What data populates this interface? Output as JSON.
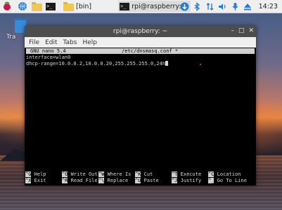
{
  "taskbar": {
    "folder_label": "[bin]",
    "terminal_label": "rpi@raspberry: ~",
    "clock": "14:23"
  },
  "desktop": {
    "trash_label": "Tra"
  },
  "window": {
    "title": "rpi@raspberry: ~",
    "menu": [
      "File",
      "Edit",
      "Tabs",
      "Help"
    ]
  },
  "editor": {
    "app": "GNU nano 5.4",
    "filename": "/etc/dnsmasq.conf *",
    "lines": [
      "interface=wlan0",
      "dhcp-range=10.0.0.2,10.0.0.20,255.255.255.0,24h"
    ]
  },
  "shortcuts": [
    {
      "key": "^G",
      "label": "Help"
    },
    {
      "key": "^X",
      "label": "Exit"
    },
    {
      "key": "^O",
      "label": "Write Out"
    },
    {
      "key": "^R",
      "label": "Read File"
    },
    {
      "key": "^W",
      "label": "Where Is"
    },
    {
      "key": "^\\",
      "label": "Replace"
    },
    {
      "key": "^K",
      "label": "Cut"
    },
    {
      "key": "^U",
      "label": "Paste"
    },
    {
      "key": "^T",
      "label": "Execute"
    },
    {
      "key": "^J",
      "label": "Justify"
    },
    {
      "key": "^C",
      "label": "Location"
    },
    {
      "key": "^_",
      "label": "Go To Line"
    }
  ],
  "icons": {
    "menu": "raspberry-icon",
    "web": "globe-icon",
    "files": "folder-icon",
    "terminal": "terminal-icon",
    "sys": [
      "bluetooth-icon",
      "network-icon",
      "volume-icon",
      "microphone-icon",
      "eject-icon",
      "update-icon"
    ]
  }
}
